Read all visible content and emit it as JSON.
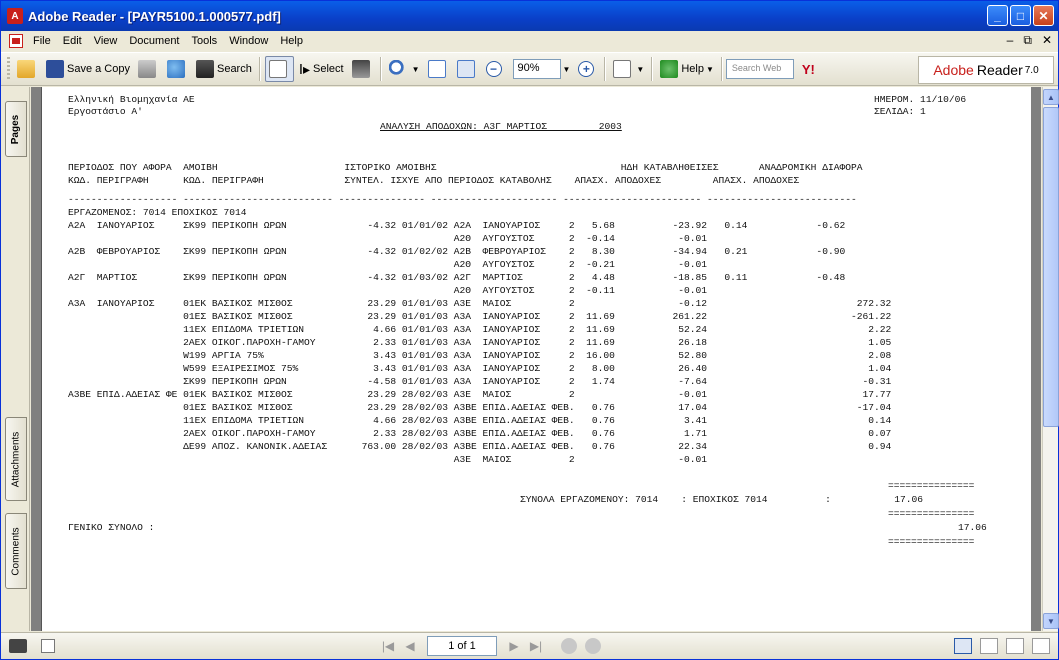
{
  "window": {
    "title": "Adobe Reader - [PAYR5100.1.000577.pdf]",
    "controls": [
      "_",
      "□",
      "✕"
    ]
  },
  "menu": {
    "items": [
      "File",
      "Edit",
      "View",
      "Document",
      "Tools",
      "Window",
      "Help"
    ],
    "right_controls": [
      "–",
      "⧉",
      "✕"
    ]
  },
  "toolbar": {
    "save_copy_label": "Save a Copy",
    "search_label": "Search",
    "select_label": "Select",
    "zoom_value": "90%",
    "help_label": "Help",
    "search_web_placeholder": "Search Web",
    "yahoo_label": "Y!",
    "brand_1": "Adobe",
    "brand_2": "Reader",
    "brand_3": "7.0"
  },
  "side_tabs": {
    "pages": "Pages",
    "attachments": "Attachments",
    "comments": "Comments"
  },
  "report": {
    "company": "Ελληνική Βιομηχανία ΑΕ",
    "plant": "Εργοστάσιο Α'",
    "date_label": "ΗΜΕΡΟΜ. 11/10/06",
    "page_label": "ΣΕΛΙΔΑ: 1",
    "title": "ΑΝΑΛΥΣΗ ΑΠΟΔΟΧΩΝ: Α3Γ ΜΑΡΤΙΟΣ         2003",
    "header_1": "ΠΕΡΙΟΔΟΣ ΠΟΥ ΑΦΟΡΑ  ΑΜΟΙΒΗ                      ΙΣΤΟΡΙΚΟ ΑΜΟΙΒΗΣ                                ΗΔΗ ΚΑΤΑΒΛΗΘΕΙΣΕΣ       ΑΝΑΔΡΟΜΙΚΗ ΔΙΑΦΟΡΑ",
    "header_2": "ΚΩΔ. ΠΕΡΙΓΡΑΦΗ      ΚΩΔ. ΠΕΡΙΓΡΑΦΗ              ΣΥΝΤΕΛ. ΙΣΧΥΕ ΑΠΟ ΠΕΡΙΟΔΟΣ ΚΑΤΑΒΟΛΗΣ    ΑΠΑΣΧ. ΑΠΟΔΟΧΕΣ         ΑΠΑΣΧ. ΑΠΟΔΟΧΕΣ",
    "divider": "------------------- -------------------------- --------------- ---------------------- ------------------------ --------------------------",
    "employee_line": "ΕΡΓΑΖΟΜΕΝΟΣ: 7014 ΕΠΟΧΙΚΟΣ 7014",
    "rows": [
      "Α2Α  ΙΑΝΟΥΑΡΙΟΣ     ΣΚ99 ΠΕΡΙΚΟΠΗ ΩΡΩΝ              -4.32 01/01/02 Α2Α  ΙΑΝΟΥΑΡΙΟΣ     2   5.68          -23.92   0.14            -0.62",
      "                                                                   Α2Θ  ΑΥΓΟΥΣΤΟΣ      2  -0.14           -0.01",
      "Α2Β  ΦΕΒΡΟΥΑΡΙΟΣ    ΣΚ99 ΠΕΡΙΚΟΠΗ ΩΡΩΝ              -4.32 01/02/02 Α2Β  ΦΕΒΡΟΥΑΡΙΟΣ    2   8.30          -34.94   0.21            -0.90",
      "                                                                   Α2Θ  ΑΥΓΟΥΣΤΟΣ      2  -0.21           -0.01",
      "Α2Γ  ΜΑΡΤΙΟΣ        ΣΚ99 ΠΕΡΙΚΟΠΗ ΩΡΩΝ              -4.32 01/03/02 Α2Γ  ΜΑΡΤΙΟΣ        2   4.48          -18.85   0.11            -0.48",
      "                                                                   Α2Θ  ΑΥΓΟΥΣΤΟΣ      2  -0.11           -0.01",
      "Α3Α  ΙΑΝΟΥΑΡΙΟΣ     01ΕΚ ΒΑΣΙΚΟΣ ΜΙΣΘΟΣ             23.29 01/01/03 Α3Ε  ΜΑΙΟΣ          2                  -0.12                          272.32",
      "                    01ΕΣ ΒΑΣΙΚΟΣ ΜΙΣΘΟΣ             23.29 01/01/03 Α3Α  ΙΑΝΟΥΑΡΙΟΣ     2  11.69          261.22                         -261.22",
      "                    11ΕΧ ΕΠΙΔΟΜΑ ΤΡΙΕΤΙΩΝ            4.66 01/01/03 Α3Α  ΙΑΝΟΥΑΡΙΟΣ     2  11.69           52.24                            2.22",
      "                    2ΑΕΧ ΟΙΚΟΓ.ΠΑΡΟΧΗ-ΓΑΜΟΥ          2.33 01/01/03 Α3Α  ΙΑΝΟΥΑΡΙΟΣ     2  11.69           26.18                            1.05",
      "                    W199 ΑΡΓΙΑ 75%                   3.43 01/01/03 Α3Α  ΙΑΝΟΥΑΡΙΟΣ     2  16.00           52.80                            2.08",
      "                    W599 ΕΞΑΙΡΕΣΙΜΟΣ 75%             3.43 01/01/03 Α3Α  ΙΑΝΟΥΑΡΙΟΣ     2   8.00           26.40                            1.04",
      "                    ΣΚ99 ΠΕΡΙΚΟΠΗ ΩΡΩΝ              -4.58 01/01/03 Α3Α  ΙΑΝΟΥΑΡΙΟΣ     2   1.74           -7.64                           -0.31",
      "Α3ΒΕ ΕΠΙΔ.ΑΔΕΙΑΣ ΦΕ 01ΕΚ ΒΑΣΙΚΟΣ ΜΙΣΘΟΣ             23.29 28/02/03 Α3Ε  ΜΑΙΟΣ          2                  -0.01                           17.77",
      "                    01ΕΣ ΒΑΣΙΚΟΣ ΜΙΣΘΟΣ             23.29 28/02/03 Α3ΒΕ ΕΠΙΔ.ΑΔΕΙΑΣ ΦΕΒ.   0.76           17.04                          -17.04",
      "                    11ΕΧ ΕΠΙΔΟΜΑ ΤΡΙΕΤΙΩΝ            4.66 28/02/03 Α3ΒΕ ΕΠΙΔ.ΑΔΕΙΑΣ ΦΕΒ.   0.76            3.41                            0.14",
      "                    2ΑΕΧ ΟΙΚΟΓ.ΠΑΡΟΧΗ-ΓΑΜΟΥ          2.33 28/02/03 Α3ΒΕ ΕΠΙΔ.ΑΔΕΙΑΣ ΦΕΒ.   0.76            1.71                            0.07",
      "                    ΔΕ99 ΑΠΟΖ. ΚΑΝΟΝΙΚ.ΑΔΕΙΑΣ      763.00 28/02/03 Α3ΒΕ ΕΠΙΔ.ΑΔΕΙΑΣ ΦΕΒ.   0.76           22.34                            0.94",
      "                                                                   Α3Ε  ΜΑΙΟΣ          2                  -0.01"
    ],
    "eq_line": "===============",
    "employee_total": "ΣΥΝΟΛΑ ΕΡΓΑΖΟΜΕΝΟΥ: 7014    : ΕΠΟΧΙΚΟΣ 7014          :           17.06",
    "grand_total_label": "ΓΕΝΙΚΟ ΣΥΝΟΛΟ :",
    "grand_total_value": "17.06"
  },
  "statusbar": {
    "page_indicator": "1 of 1"
  }
}
